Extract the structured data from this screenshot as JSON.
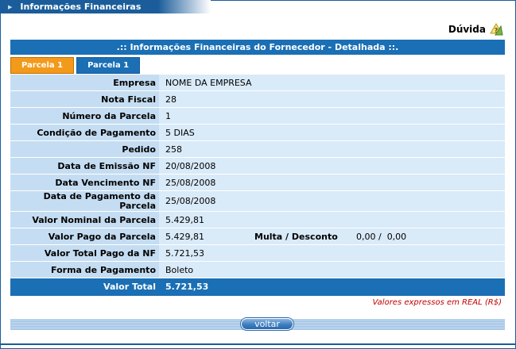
{
  "window": {
    "title": "Informações Financeiras"
  },
  "help": {
    "label": "Dúvida"
  },
  "panel": {
    "header": ".:: Informações Financeiras do Fornecedor - Detalhada ::.",
    "tabs": [
      {
        "label": "Parcela 1",
        "active": true
      },
      {
        "label": "Parcela 1",
        "active": false
      }
    ],
    "rows": [
      {
        "label": "Empresa",
        "value": "NOME DA EMPRESA"
      },
      {
        "label": "Nota Fiscal",
        "value": "28"
      },
      {
        "label": "Número da Parcela",
        "value": "1"
      },
      {
        "label": "Condição de Pagamento",
        "value": "5 DIAS"
      },
      {
        "label": "Pedido",
        "value": "258"
      },
      {
        "label": "Data de Emissão NF",
        "value": "20/08/2008"
      },
      {
        "label": "Data Vencimento NF",
        "value": "25/08/2008"
      },
      {
        "label": "Data de Pagamento da Parcela",
        "value": "25/08/2008"
      },
      {
        "label": "Valor Nominal da Parcela",
        "value": "5.429,81"
      },
      {
        "label": "Valor Pago da Parcela",
        "value": "5.429,81",
        "extra_label": "Multa / Desconto",
        "extra_value": "0,00 /  0,00"
      },
      {
        "label": "Valor Total Pago da NF",
        "value": "5.721,53"
      },
      {
        "label": "Forma de Pagamento",
        "value": "Boleto"
      }
    ],
    "total": {
      "label": "Valor Total",
      "value": "5.721,53"
    },
    "note": "Valores expressos em REAL (R$)"
  },
  "footer": {
    "button_label": "voltar"
  },
  "colors": {
    "header_blue": "#1a6fb5",
    "label_bg": "#c5ddf2",
    "value_bg": "#d9eaf8",
    "active_tab": "#f39a1b",
    "note_red": "#c00000"
  }
}
